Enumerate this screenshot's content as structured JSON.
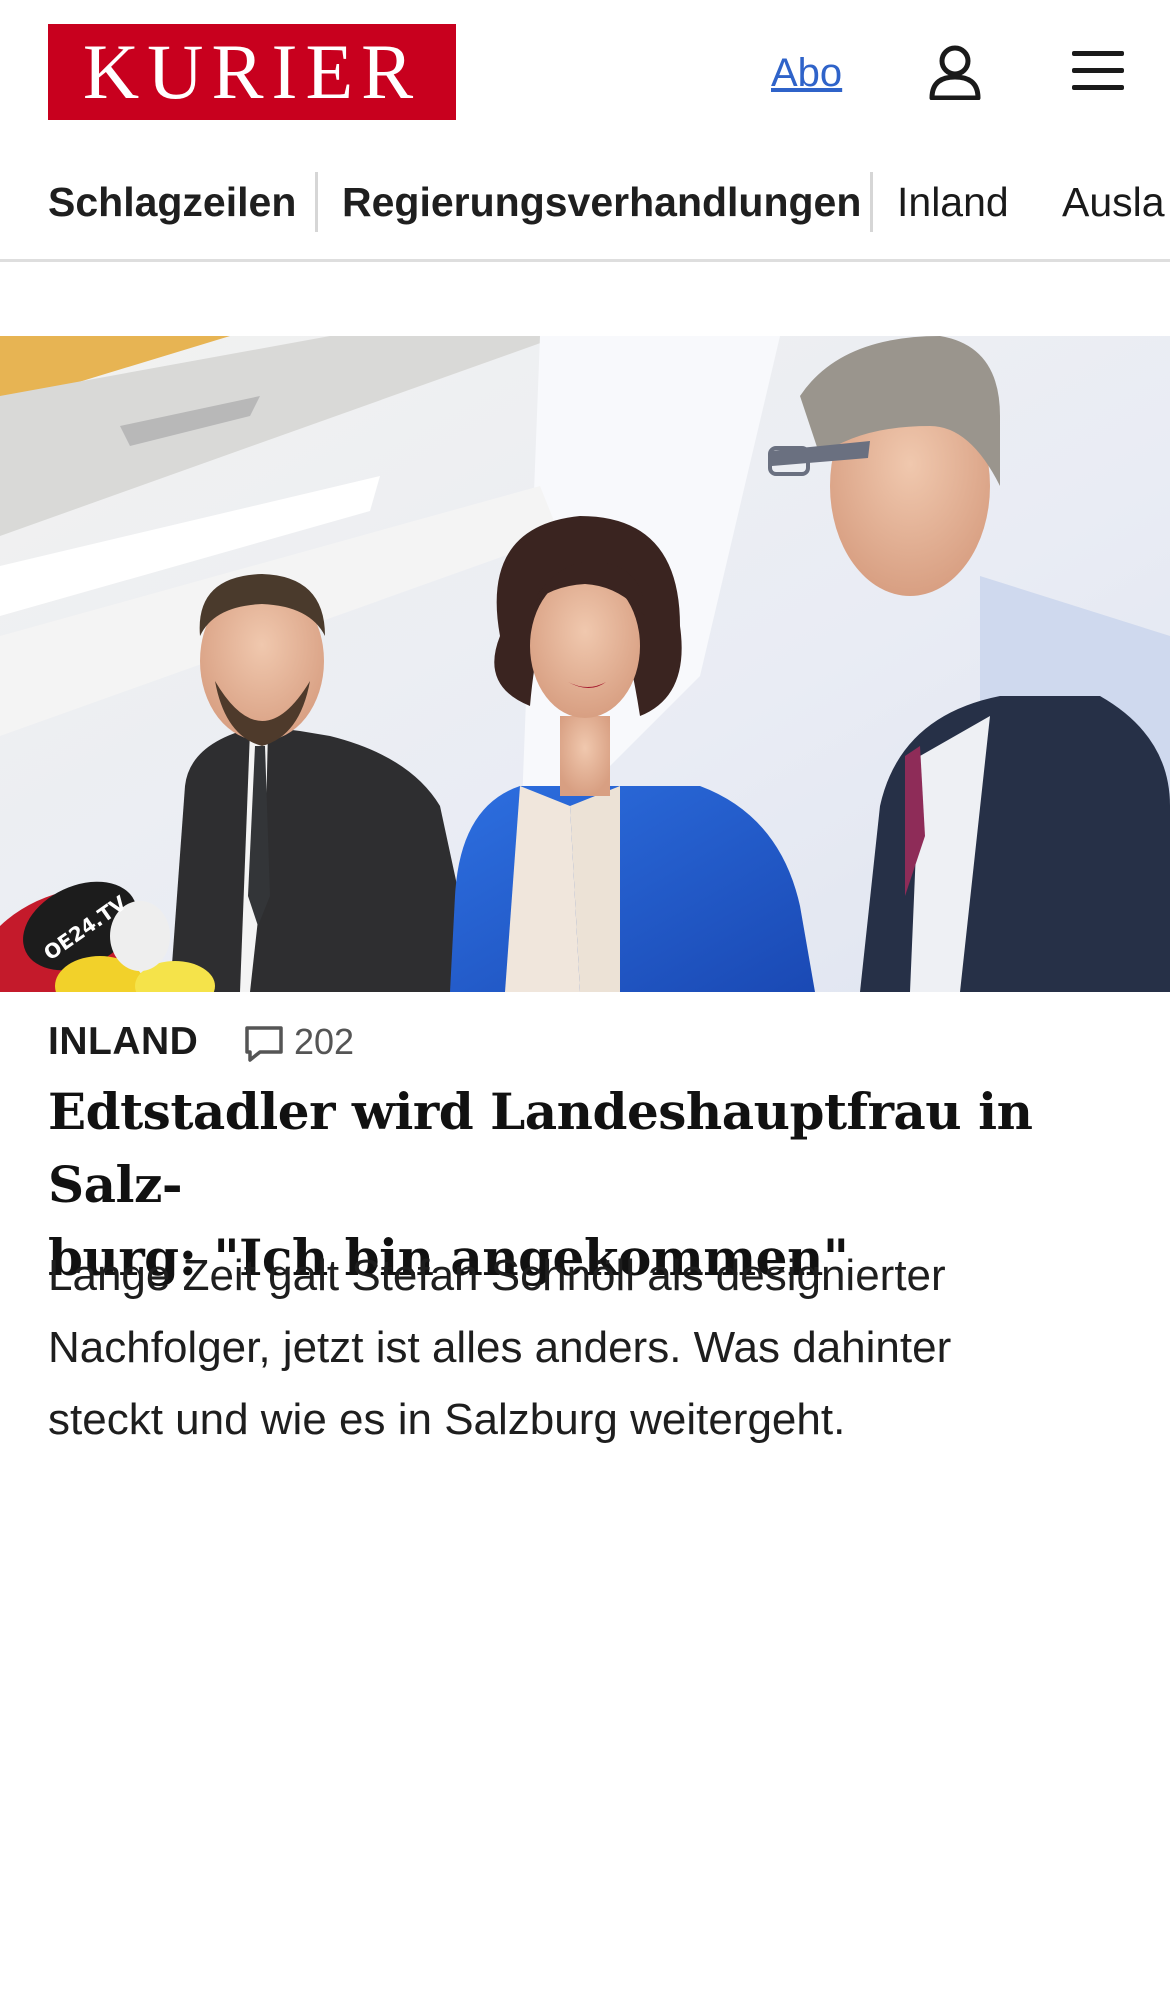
{
  "header": {
    "logo_text": "KURIER",
    "abo_label": "Abo",
    "brand_color": "#c8001e",
    "link_color": "#2f63c9",
    "user_icon": "user-icon",
    "menu_icon": "hamburger-menu-icon"
  },
  "nav": {
    "items": [
      {
        "label": "Schlagzeilen",
        "bold": true
      },
      {
        "label": "Regierungsverhandlungen",
        "bold": true
      },
      {
        "label": "Inland",
        "bold": false
      },
      {
        "label": "Ausla",
        "bold": false
      }
    ]
  },
  "article": {
    "category": "INLAND",
    "comment_icon": "comment-icon",
    "comment_count": "202",
    "headline_line1": "Edtstadler wird Landeshauptfrau in Salz-",
    "headline_line2": "burg: \"Ich bin angekommen\"",
    "teaser_line1": "Lange Zeit galt Stefan Schnöll als designierter",
    "teaser_line2": "Nachfolger, jetzt ist alles anders. Was dahinter",
    "teaser_line3": "steckt und wie es in Salzburg weitergeht.",
    "image_mic_label": "OE24.TV"
  }
}
